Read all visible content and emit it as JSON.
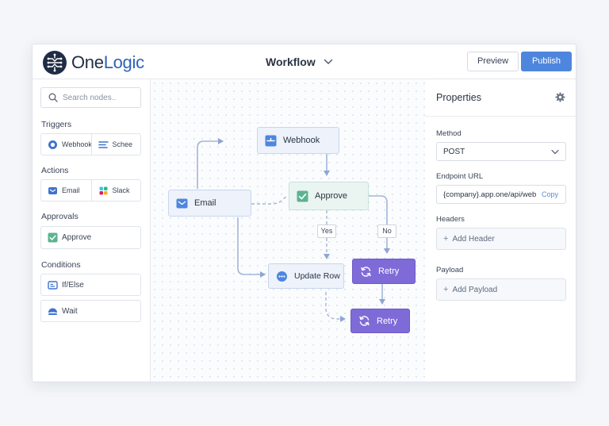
{
  "app": {
    "brand_part1": "One",
    "brand_part2": "Logic",
    "workflow_title": "Workflow",
    "preview_label": "Preview",
    "publish_label": "Publish"
  },
  "sidebar": {
    "search_placeholder": "Search nodes..",
    "sections": {
      "triggers": "Triggers",
      "actions": "Actions",
      "approvals": "Approvals",
      "conditions": "Conditions"
    },
    "items": {
      "webhook": "Webhook",
      "schedule": "Schee",
      "email": "Email",
      "slack": "Slack",
      "approve": "Approve",
      "ifelse": "If/Else",
      "wait": "Wait"
    }
  },
  "canvas": {
    "nodes": {
      "webhook": "Webhook",
      "email": "Email",
      "approve": "Approve",
      "update_row": "Update Row",
      "retry1": "Retry",
      "retry2": "Retry"
    },
    "edge_labels": {
      "yes": "Yes",
      "no": "No"
    }
  },
  "properties": {
    "title": "Properties",
    "method_label": "Method",
    "method_value": "POST",
    "endpoint_label": "Endpoint URL",
    "endpoint_value": "{company}.app.one/api/web",
    "copy_label": "Copy",
    "headers_label": "Headers",
    "add_header": "Add Header",
    "payload_label": "Payload",
    "add_payload": "Add Payload"
  },
  "colors": {
    "accent": "#4e86de",
    "brand_dark": "#1f2d44",
    "brand_blue": "#2f63b8",
    "node_purple": "#7f6bd8",
    "node_green": "#5cb391"
  }
}
